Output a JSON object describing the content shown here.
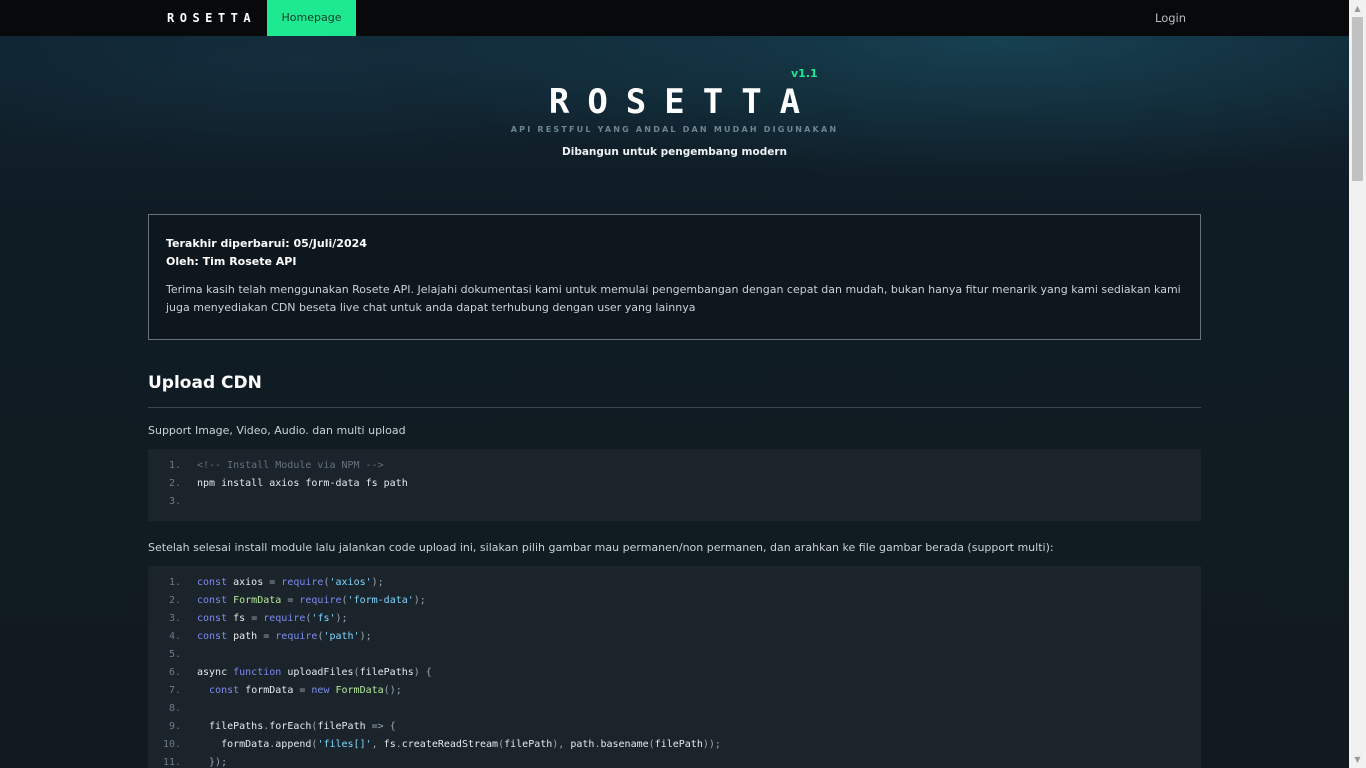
{
  "nav": {
    "brand": "ROSETTA",
    "homepage": "Homepage",
    "login": "Login"
  },
  "hero": {
    "title": "ROSETTA",
    "version": "v1.1",
    "tagline": "API RESTFUL YANG ANDAL DAN MUDAH DIGUNAKAN",
    "subtitle": "Dibangun untuk pengembang modern"
  },
  "info": {
    "updated": "Terakhir diperbarui: 05/Juli/2024",
    "author": "Oleh: Tim Rosete API",
    "description": "Terima kasih telah menggunakan Rosete API. Jelajahi dokumentasi kami untuk memulai pengembangan dengan cepat dan mudah, bukan hanya fitur menarik yang kami sediakan kami juga menyediakan CDN beseta live chat untuk anda dapat terhubung dengan user yang lainnya"
  },
  "section": {
    "title": "Upload CDN",
    "support_text": "Support Image, Video, Audio. dan multi upload",
    "after_install_text": "Setelah selesai install module lalu jalankan code upload ini, silakan pilih gambar mau permanen/non permanen, dan arahkan ke file gambar berada (support multi):"
  },
  "code_install": [
    {
      "n": "1.",
      "tokens": [
        [
          "c-comment",
          "<!-- Install Module via NPM -->"
        ]
      ]
    },
    {
      "n": "2.",
      "tokens": [
        [
          "c-var",
          "npm install axios form-data fs path"
        ]
      ]
    },
    {
      "n": "3.",
      "tokens": []
    }
  ],
  "code_upload": [
    {
      "n": "1.",
      "tokens": [
        [
          "c-kw",
          "const "
        ],
        [
          "c-var",
          "axios "
        ],
        [
          "c-op",
          "= "
        ],
        [
          "c-kw",
          "require"
        ],
        [
          "c-op",
          "("
        ],
        [
          "c-str",
          "'axios'"
        ],
        [
          "c-op",
          ");"
        ]
      ]
    },
    {
      "n": "2.",
      "tokens": [
        [
          "c-kw",
          "const "
        ],
        [
          "c-cls",
          "FormData "
        ],
        [
          "c-op",
          "= "
        ],
        [
          "c-kw",
          "require"
        ],
        [
          "c-op",
          "("
        ],
        [
          "c-str",
          "'form-data'"
        ],
        [
          "c-op",
          ");"
        ]
      ]
    },
    {
      "n": "3.",
      "tokens": [
        [
          "c-kw",
          "const "
        ],
        [
          "c-var",
          "fs "
        ],
        [
          "c-op",
          "= "
        ],
        [
          "c-kw",
          "require"
        ],
        [
          "c-op",
          "("
        ],
        [
          "c-str",
          "'fs'"
        ],
        [
          "c-op",
          ");"
        ]
      ]
    },
    {
      "n": "4.",
      "tokens": [
        [
          "c-kw",
          "const "
        ],
        [
          "c-var",
          "path "
        ],
        [
          "c-op",
          "= "
        ],
        [
          "c-kw",
          "require"
        ],
        [
          "c-op",
          "("
        ],
        [
          "c-str",
          "'path'"
        ],
        [
          "c-op",
          ");"
        ]
      ]
    },
    {
      "n": "5.",
      "tokens": []
    },
    {
      "n": "6.",
      "tokens": [
        [
          "c-var",
          "async "
        ],
        [
          "c-kw",
          "function "
        ],
        [
          "c-var",
          "uploadFiles"
        ],
        [
          "c-op",
          "("
        ],
        [
          "c-var",
          "filePaths"
        ],
        [
          "c-op",
          ") {"
        ]
      ]
    },
    {
      "n": "7.",
      "tokens": [
        [
          "c-var",
          "  "
        ],
        [
          "c-kw",
          "const "
        ],
        [
          "c-var",
          "formData "
        ],
        [
          "c-op",
          "= "
        ],
        [
          "c-kw",
          "new "
        ],
        [
          "c-cls",
          "FormData"
        ],
        [
          "c-op",
          "();"
        ]
      ]
    },
    {
      "n": "8.",
      "tokens": []
    },
    {
      "n": "9.",
      "tokens": [
        [
          "c-var",
          "  filePaths"
        ],
        [
          "c-op",
          "."
        ],
        [
          "c-var",
          "forEach"
        ],
        [
          "c-op",
          "("
        ],
        [
          "c-var",
          "filePath "
        ],
        [
          "c-op",
          "=> {"
        ]
      ]
    },
    {
      "n": "10.",
      "tokens": [
        [
          "c-var",
          "    formData"
        ],
        [
          "c-op",
          "."
        ],
        [
          "c-var",
          "append"
        ],
        [
          "c-op",
          "("
        ],
        [
          "c-str",
          "'files[]'"
        ],
        [
          "c-op",
          ", "
        ],
        [
          "c-var",
          "fs"
        ],
        [
          "c-op",
          "."
        ],
        [
          "c-var",
          "createReadStream"
        ],
        [
          "c-op",
          "("
        ],
        [
          "c-var",
          "filePath"
        ],
        [
          "c-op",
          "), "
        ],
        [
          "c-var",
          "path"
        ],
        [
          "c-op",
          "."
        ],
        [
          "c-var",
          "basename"
        ],
        [
          "c-op",
          "("
        ],
        [
          "c-var",
          "filePath"
        ],
        [
          "c-op",
          "));"
        ]
      ]
    },
    {
      "n": "11.",
      "tokens": [
        [
          "c-op",
          "  });"
        ]
      ]
    }
  ]
}
